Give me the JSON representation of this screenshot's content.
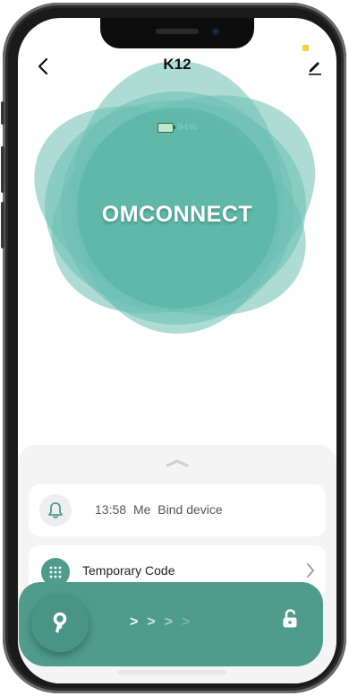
{
  "header": {
    "title": "K12",
    "back_icon": "chevron-left-icon",
    "edit_icon": "pencil-icon"
  },
  "device": {
    "battery_percent": "94%",
    "battery_level": 0.94,
    "brand": "OMCONNECT"
  },
  "notification": {
    "time": "13:58",
    "user": "Me",
    "message": "Bind device",
    "icon": "bell-icon"
  },
  "menu": {
    "temporary_code_label": "Temporary Code",
    "icon": "keypad-grid-icon"
  },
  "unlock": {
    "key_icon": "key-icon",
    "lock_icon": "unlock-icon",
    "arrows": [
      ">",
      ">",
      ">",
      ">"
    ]
  },
  "colors": {
    "accent": "#4f9c8d",
    "blob": "#6cc0b3",
    "status_yellow": "#f4d03f"
  }
}
